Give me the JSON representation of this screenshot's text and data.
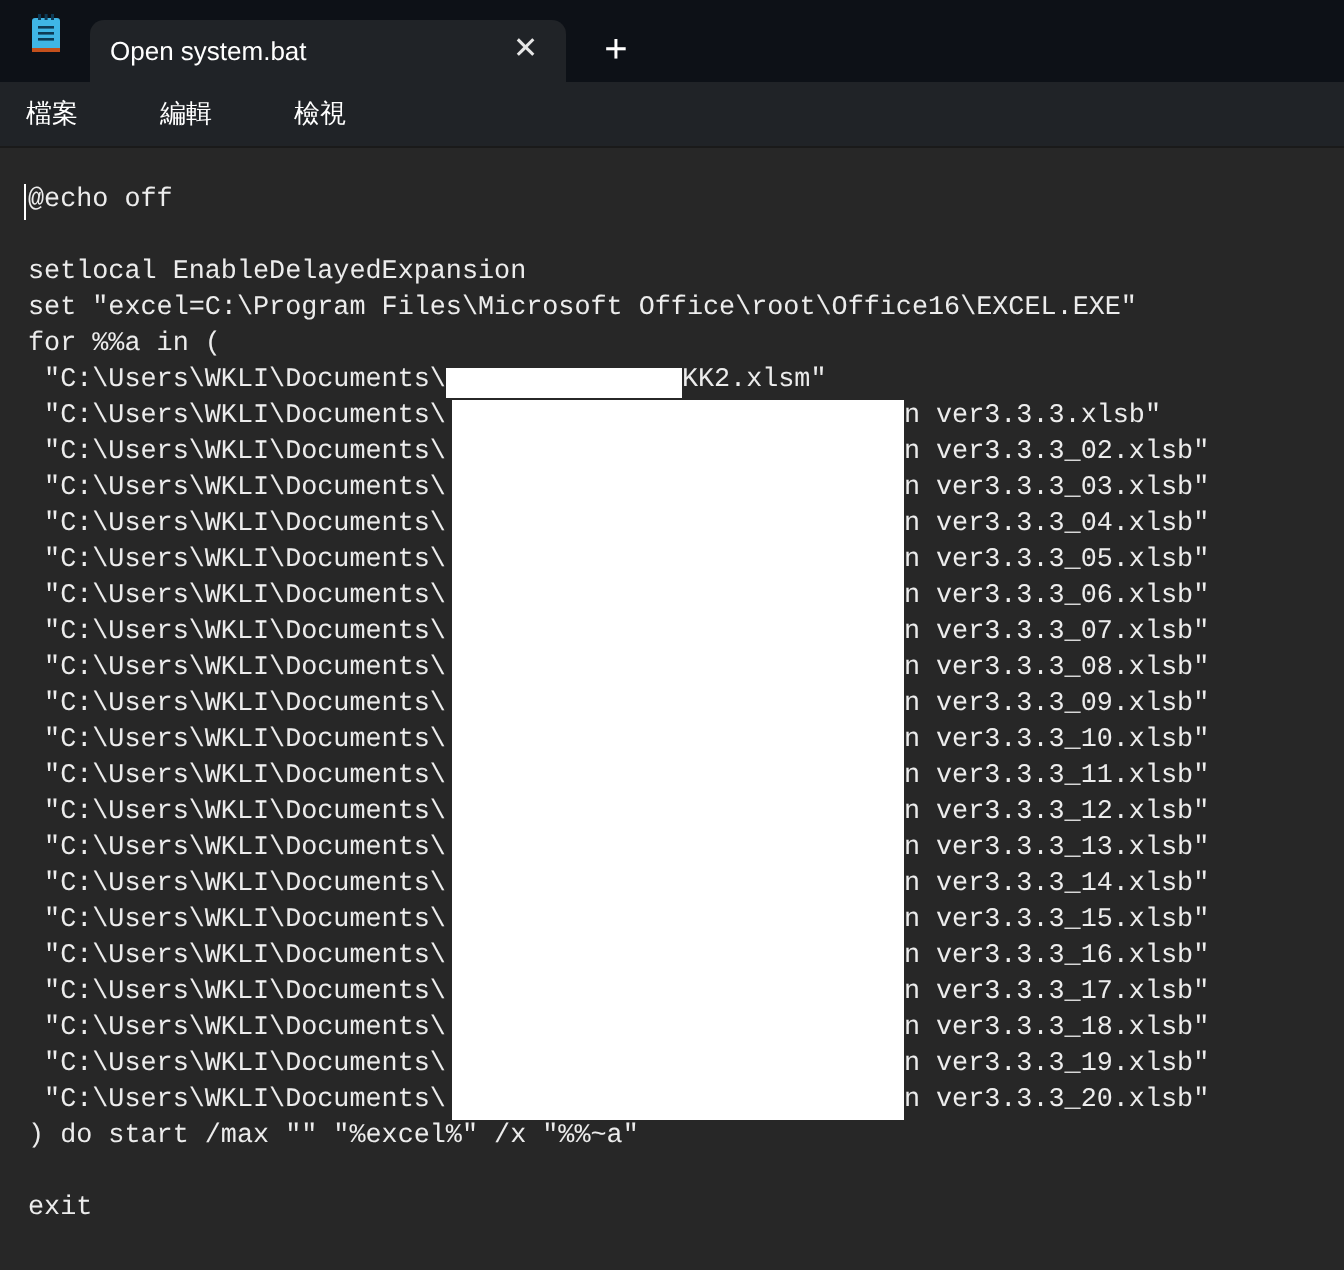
{
  "tab": {
    "title": "Open system.bat",
    "selected": true,
    "close": "✕"
  },
  "new_tab": "+",
  "menu": [
    "檔案",
    "編輯",
    "檢視"
  ],
  "editor": {
    "lines": [
      {
        "kind": "code",
        "text": "@echo off"
      },
      {
        "kind": "blank"
      },
      {
        "kind": "code",
        "text": "setlocal EnableDelayedExpansion"
      },
      {
        "kind": "code",
        "text": "set \"excel=C:\\Program Files\\Microsoft Office\\root\\Office16\\EXCEL.EXE\""
      },
      {
        "kind": "code",
        "text": "for %%a in ("
      },
      {
        "kind": "redacted_name",
        "before": " \"C:\\Users\\WKLI\\Documents\\",
        "after": "KK2.xlsm\""
      },
      {
        "kind": "redacted_path",
        "before": " \"C:\\Users\\WKLI\\Documents\\",
        "after": "n ver3.3.3.xlsb\""
      },
      {
        "kind": "redacted_path",
        "before": " \"C:\\Users\\WKLI\\Documents\\",
        "after": "n ver3.3.3_02.xlsb\""
      },
      {
        "kind": "redacted_path",
        "before": " \"C:\\Users\\WKLI\\Documents\\",
        "after": "n ver3.3.3_03.xlsb\""
      },
      {
        "kind": "redacted_path",
        "before": " \"C:\\Users\\WKLI\\Documents\\",
        "after": "n ver3.3.3_04.xlsb\""
      },
      {
        "kind": "redacted_path",
        "before": " \"C:\\Users\\WKLI\\Documents\\",
        "after": "n ver3.3.3_05.xlsb\""
      },
      {
        "kind": "redacted_path",
        "before": " \"C:\\Users\\WKLI\\Documents\\",
        "after": "n ver3.3.3_06.xlsb\""
      },
      {
        "kind": "redacted_path",
        "before": " \"C:\\Users\\WKLI\\Documents\\",
        "after": "n ver3.3.3_07.xlsb\""
      },
      {
        "kind": "redacted_path",
        "before": " \"C:\\Users\\WKLI\\Documents\\",
        "after": "n ver3.3.3_08.xlsb\""
      },
      {
        "kind": "redacted_path",
        "before": " \"C:\\Users\\WKLI\\Documents\\",
        "after": "n ver3.3.3_09.xlsb\""
      },
      {
        "kind": "redacted_path",
        "before": " \"C:\\Users\\WKLI\\Documents\\",
        "after": "n ver3.3.3_10.xlsb\""
      },
      {
        "kind": "redacted_path",
        "before": " \"C:\\Users\\WKLI\\Documents\\",
        "after": "n ver3.3.3_11.xlsb\""
      },
      {
        "kind": "redacted_path",
        "before": " \"C:\\Users\\WKLI\\Documents\\",
        "after": "n ver3.3.3_12.xlsb\""
      },
      {
        "kind": "redacted_path",
        "before": " \"C:\\Users\\WKLI\\Documents\\",
        "after": "n ver3.3.3_13.xlsb\""
      },
      {
        "kind": "redacted_path",
        "before": " \"C:\\Users\\WKLI\\Documents\\",
        "after": "n ver3.3.3_14.xlsb\""
      },
      {
        "kind": "redacted_path",
        "before": " \"C:\\Users\\WKLI\\Documents\\",
        "after": "n ver3.3.3_15.xlsb\""
      },
      {
        "kind": "redacted_path",
        "before": " \"C:\\Users\\WKLI\\Documents\\",
        "after": "n ver3.3.3_16.xlsb\""
      },
      {
        "kind": "redacted_path",
        "before": " \"C:\\Users\\WKLI\\Documents\\",
        "after": "n ver3.3.3_17.xlsb\""
      },
      {
        "kind": "redacted_path",
        "before": " \"C:\\Users\\WKLI\\Documents\\",
        "after": "n ver3.3.3_18.xlsb\""
      },
      {
        "kind": "redacted_path",
        "before": " \"C:\\Users\\WKLI\\Documents\\",
        "after": "n ver3.3.3_19.xlsb\""
      },
      {
        "kind": "redacted_path",
        "before": " \"C:\\Users\\WKLI\\Documents\\",
        "after": "n ver3.3.3_20.xlsb\""
      },
      {
        "kind": "code",
        "text": ") do start /max \"\" \"%excel%\" /x \"%%~a\""
      },
      {
        "kind": "blank"
      },
      {
        "kind": "code",
        "text": "exit"
      }
    ]
  }
}
